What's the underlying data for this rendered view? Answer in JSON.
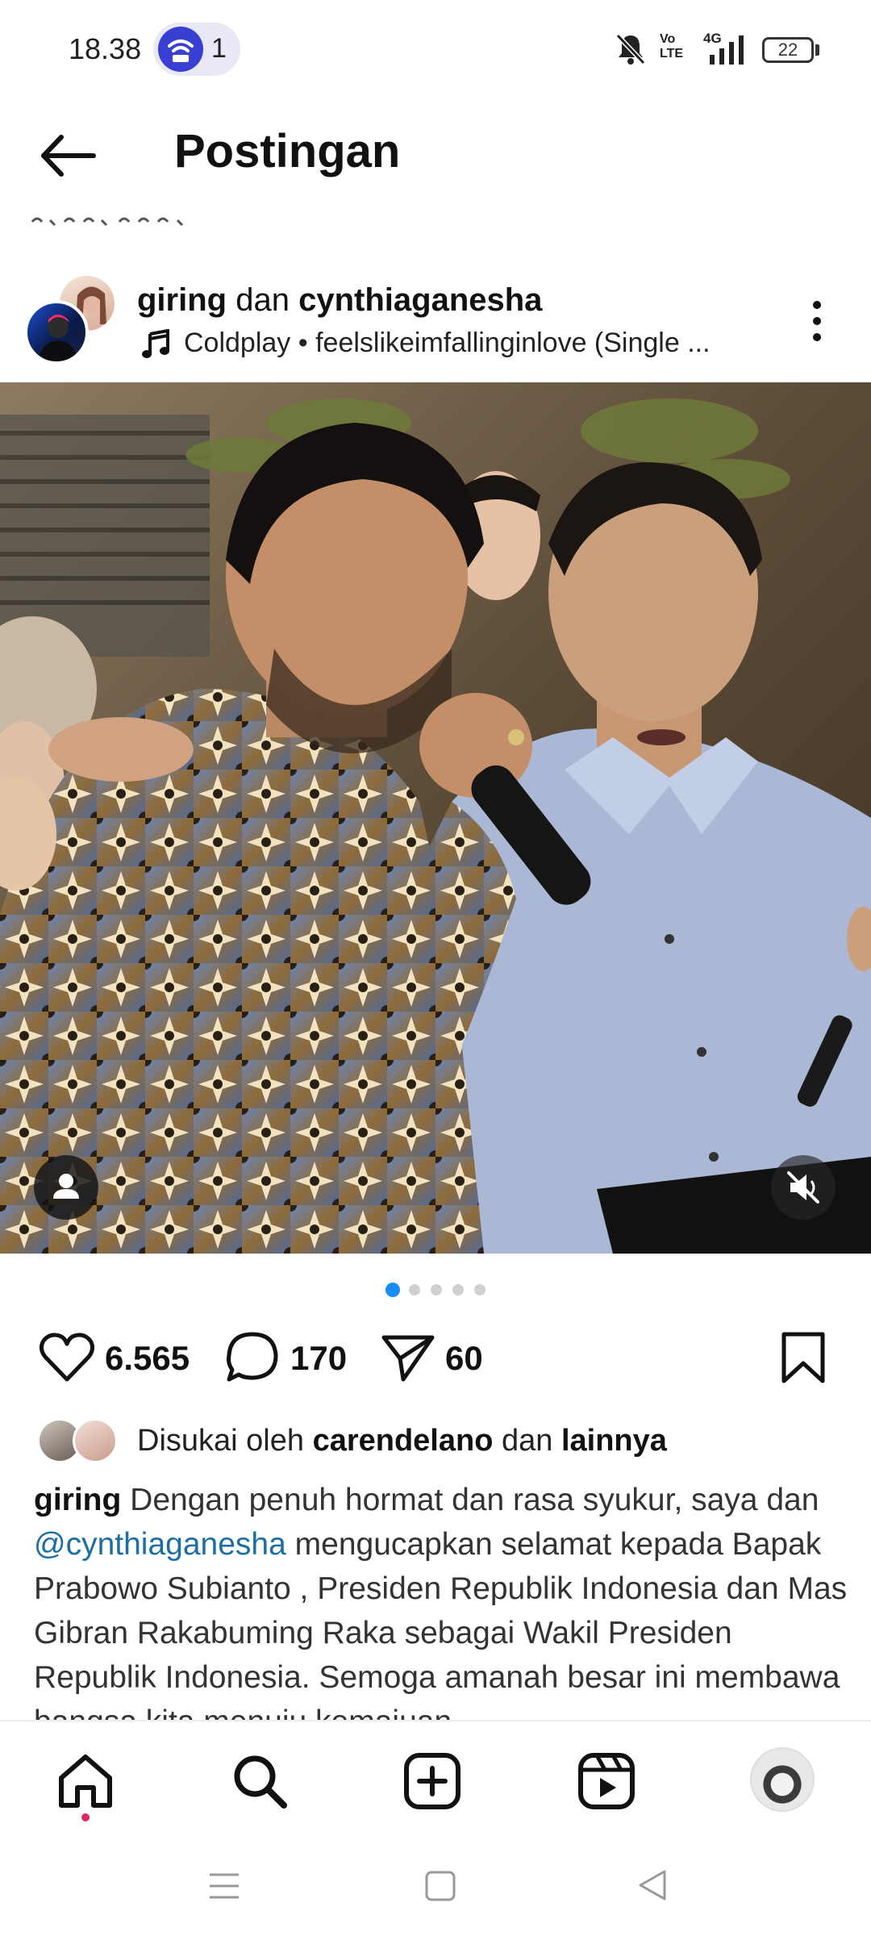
{
  "status_bar": {
    "time": "18.38",
    "hotspot_count": "1",
    "network": "4G",
    "volte_label": "Vo LTE",
    "battery": "22"
  },
  "header": {
    "title": "Postingan"
  },
  "post": {
    "author_primary": "giring",
    "author_connector": "dan",
    "author_secondary": "cynthiaganesha",
    "audio": "Coldplay • feelslikeimfallinginlove (Single ...",
    "carousel": {
      "total": 5,
      "active": 1
    },
    "likes": "6.565",
    "comments": "170",
    "shares": "60",
    "liked_by": {
      "prefix": "Disukai oleh",
      "user": "carendelano",
      "connector": "dan",
      "others": "lainnya"
    },
    "caption": {
      "username": "giring",
      "text_1": "Dengan penuh hormat dan rasa syukur, saya dan",
      "mention": "@cynthiaganesha",
      "text_2": "mengucapkan selamat kepada Bapak Prabowo Subianto , Presiden Republik Indonesia dan Mas Gibran Rakabuming Raka sebagai Wakil Presiden Republik Indonesia. Semoga amanah besar ini membawa bangsa kita menuju kemajuan"
    }
  },
  "icons": {
    "back": "arrow-left",
    "more": "three-dots-vertical",
    "music": "music-note",
    "tag_people": "person",
    "photo_mute": "speaker-muted",
    "like": "heart",
    "comment": "speech-bubble",
    "share": "paper-plane",
    "save": "bookmark",
    "nav_home": "home",
    "nav_search": "magnifier",
    "nav_create": "plus-square",
    "nav_reels": "play-square"
  },
  "colors": {
    "accent_blue": "#1c6ea4",
    "dot_active": "#1a8df5",
    "dot_inactive": "#d0d0d0",
    "notification_dot": "#e0245e",
    "hotspot_blue": "#3a3fd4"
  }
}
